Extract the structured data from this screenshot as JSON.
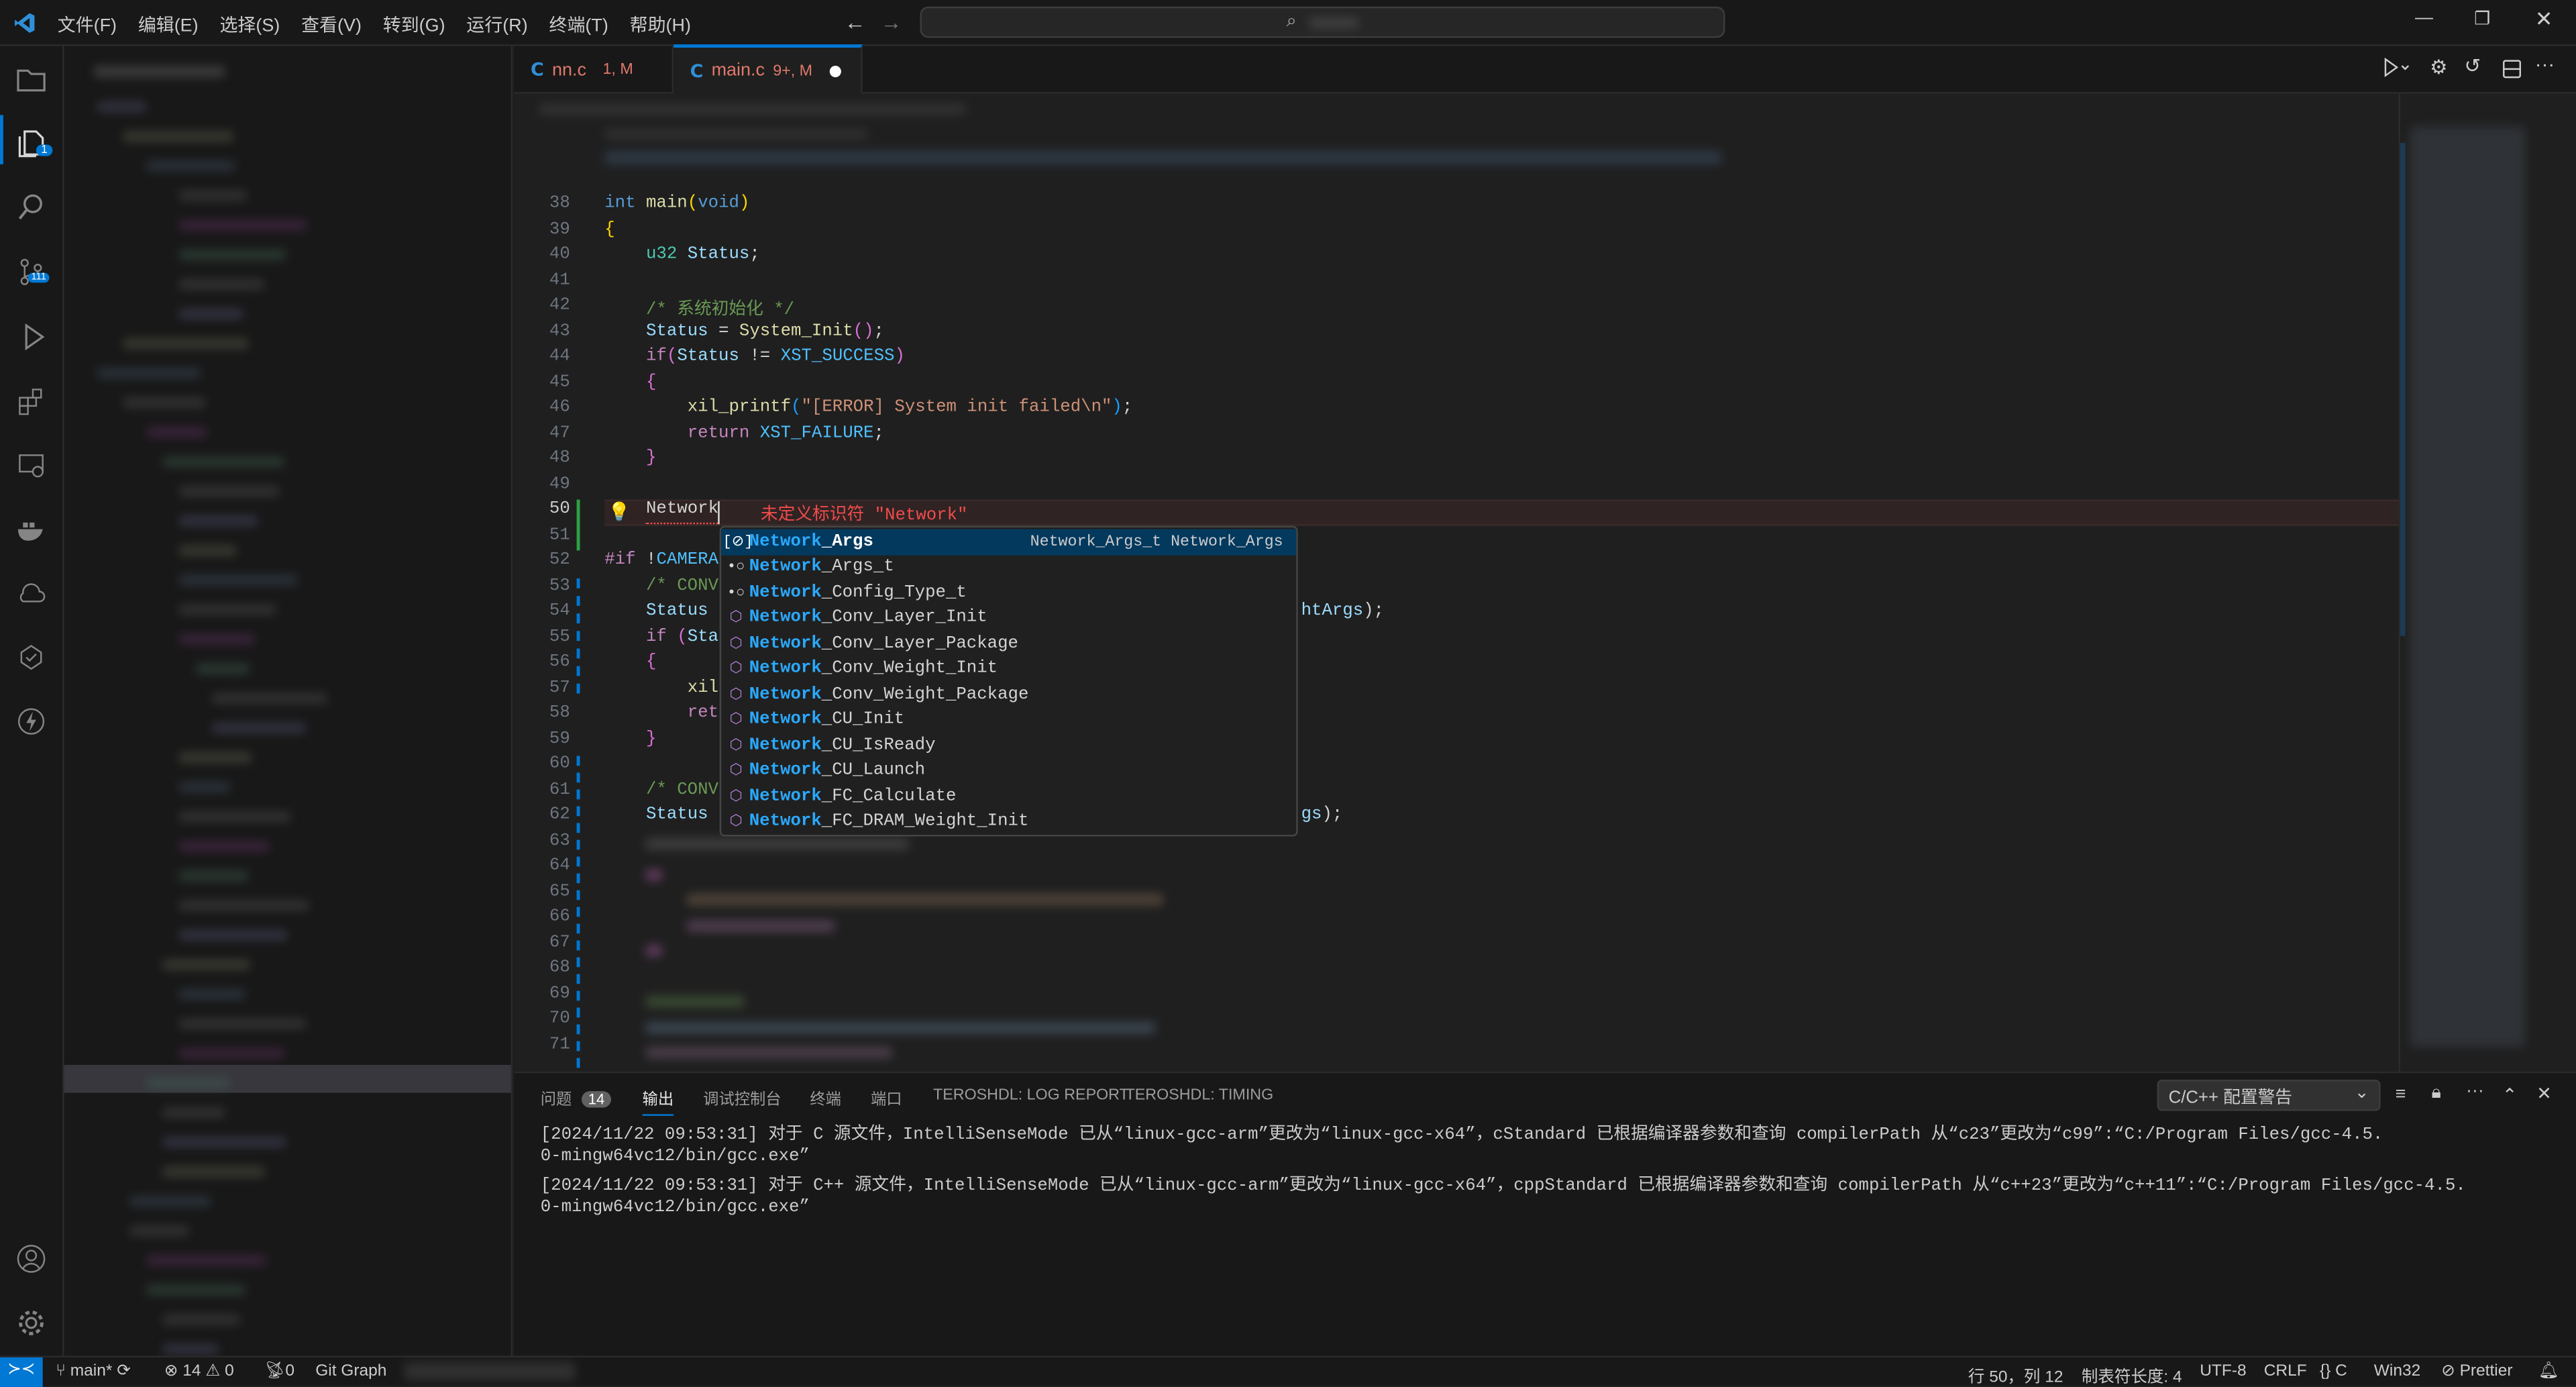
{
  "menu": [
    "文件(F)",
    "编辑(E)",
    "选择(S)",
    "查看(V)",
    "转到(G)",
    "运行(R)",
    "终端(T)",
    "帮助(H)"
  ],
  "tabs": [
    {
      "icon": "C",
      "name": "nn.c",
      "status": "1, M"
    },
    {
      "icon": "C",
      "name": "main.c",
      "status": "9+, M",
      "dirty": true
    }
  ],
  "activity": {
    "explorer_badge": "1",
    "scm_badge": "111"
  },
  "editor": {
    "lines": [
      {
        "n": "38",
        "t": [
          [
            "int ",
            "kw"
          ],
          [
            "main",
            "fn"
          ],
          [
            "(",
            "br1"
          ],
          [
            "void",
            "kw"
          ],
          [
            ")",
            "br1"
          ]
        ]
      },
      {
        "n": "39",
        "t": [
          [
            "{",
            "br1"
          ]
        ]
      },
      {
        "n": "40",
        "t": [
          [
            "    ",
            ""
          ],
          [
            "u32 ",
            "ty"
          ],
          [
            "Status",
            "va"
          ],
          [
            ";",
            "pl"
          ]
        ]
      },
      {
        "n": "41",
        "t": []
      },
      {
        "n": "42",
        "t": [
          [
            "    /* 系统初始化 */",
            "cm"
          ]
        ]
      },
      {
        "n": "43",
        "t": [
          [
            "    ",
            ""
          ],
          [
            "Status",
            "va"
          ],
          [
            " = ",
            "pl"
          ],
          [
            "System_Init",
            "fn"
          ],
          [
            "()",
            "br2"
          ],
          [
            ";",
            "pl"
          ]
        ]
      },
      {
        "n": "44",
        "t": [
          [
            "    ",
            ""
          ],
          [
            "if",
            "pk"
          ],
          [
            "(",
            "br2"
          ],
          [
            "Status",
            "va"
          ],
          [
            " != ",
            "pl"
          ],
          [
            "XST_SUCCESS",
            "cn"
          ],
          [
            ")",
            "br2"
          ]
        ]
      },
      {
        "n": "45",
        "t": [
          [
            "    ",
            ""
          ],
          [
            "{",
            "br2"
          ]
        ]
      },
      {
        "n": "46",
        "t": [
          [
            "        ",
            ""
          ],
          [
            "xil_printf",
            "fn"
          ],
          [
            "(",
            "br3"
          ],
          [
            "\"[ERROR] System init failed\\n\"",
            "str"
          ],
          [
            ")",
            "br3"
          ],
          [
            ";",
            "pl"
          ]
        ]
      },
      {
        "n": "47",
        "t": [
          [
            "        ",
            ""
          ],
          [
            "return ",
            "pk"
          ],
          [
            "XST_FAILURE",
            "cn"
          ],
          [
            ";",
            "pl"
          ]
        ]
      },
      {
        "n": "48",
        "t": [
          [
            "    ",
            ""
          ],
          [
            "}",
            "br2"
          ]
        ]
      },
      {
        "n": "49",
        "t": []
      },
      {
        "n": "50",
        "t": [
          [
            "    ",
            ""
          ],
          [
            "Network",
            "pl"
          ]
        ]
      },
      {
        "n": "51",
        "t": []
      },
      {
        "n": "52",
        "t": [
          [
            "#if ",
            "pk"
          ],
          [
            "!",
            "pl"
          ],
          [
            "CAMERA",
            "cn"
          ]
        ]
      },
      {
        "n": "53",
        "t": [
          [
            "    /* CONV",
            "cm"
          ]
        ]
      },
      {
        "n": "54",
        "t": [
          [
            "    ",
            ""
          ],
          [
            "Status",
            "va"
          ]
        ],
        "tail": [
          [
            "htArgs",
            "va"
          ],
          [
            ");",
            "pl"
          ]
        ]
      },
      {
        "n": "55",
        "t": [
          [
            "    ",
            ""
          ],
          [
            "if ",
            "pk"
          ],
          [
            "(",
            "br2"
          ],
          [
            "Sta",
            "va"
          ]
        ]
      },
      {
        "n": "56",
        "t": [
          [
            "    ",
            ""
          ],
          [
            "{",
            "br2"
          ]
        ]
      },
      {
        "n": "57",
        "t": [
          [
            "        ",
            ""
          ],
          [
            "xil",
            "fn"
          ]
        ]
      },
      {
        "n": "58",
        "t": [
          [
            "        ",
            ""
          ],
          [
            "ret",
            "pk"
          ]
        ]
      },
      {
        "n": "59",
        "t": [
          [
            "    ",
            ""
          ],
          [
            "}",
            "br2"
          ]
        ]
      },
      {
        "n": "60",
        "t": []
      },
      {
        "n": "61",
        "t": [
          [
            "    /* CONV",
            "cm"
          ]
        ]
      },
      {
        "n": "62",
        "t": [
          [
            "    ",
            ""
          ],
          [
            "Status",
            "va"
          ]
        ],
        "tail": [
          [
            "gs",
            "va"
          ],
          [
            ");",
            "pl"
          ]
        ]
      },
      {
        "n": "63",
        "t": []
      },
      {
        "n": "64",
        "t": []
      },
      {
        "n": "65",
        "t": []
      },
      {
        "n": "66",
        "t": []
      },
      {
        "n": "67",
        "t": []
      },
      {
        "n": "68",
        "t": []
      },
      {
        "n": "69",
        "t": []
      },
      {
        "n": "70",
        "t": []
      },
      {
        "n": "71",
        "t": []
      }
    ],
    "error_message": "未定义标识符 \"Network\""
  },
  "suggest": {
    "typed": "Network",
    "detail": "Network_Args_t Network_Args",
    "items": [
      {
        "kind": "variable",
        "rest": "_Args"
      },
      {
        "kind": "typedef",
        "rest": "_Args_t"
      },
      {
        "kind": "typedef",
        "rest": "_Config_Type_t"
      },
      {
        "kind": "function",
        "rest": "_Conv_Layer_Init"
      },
      {
        "kind": "function",
        "rest": "_Conv_Layer_Package"
      },
      {
        "kind": "function",
        "rest": "_Conv_Weight_Init"
      },
      {
        "kind": "function",
        "rest": "_Conv_Weight_Package"
      },
      {
        "kind": "function",
        "rest": "_CU_Init"
      },
      {
        "kind": "function",
        "rest": "_CU_IsReady"
      },
      {
        "kind": "function",
        "rest": "_CU_Launch"
      },
      {
        "kind": "function",
        "rest": "_FC_Calculate"
      },
      {
        "kind": "function",
        "rest": "_FC_DRAM_Weight_Init"
      }
    ]
  },
  "panel": {
    "tabs": [
      {
        "label": "问题",
        "badge": "14"
      },
      {
        "label": "输出",
        "active": true
      },
      {
        "label": "调试控制台"
      },
      {
        "label": "终端"
      },
      {
        "label": "端口"
      },
      {
        "label": "TEROSHDL: LOG REPORT"
      },
      {
        "label": "TEROSHDL: TIMING"
      }
    ],
    "channel": "C/C++ 配置警告",
    "output": [
      "[2024/11/22 09:53:31] 对于 C 源文件，IntelliSenseMode 已从“linux-gcc-arm”更改为“linux-gcc-x64”，cStandard 已根据编译器参数和查询 compilerPath 从“c23”更改为“c99”:“C:/Program Files/gcc-4.5.",
      "0-mingw64vc12/bin/gcc.exe”",
      "[2024/11/22 09:53:31] 对于 C++ 源文件，IntelliSenseMode 已从“linux-gcc-arm”更改为“linux-gcc-x64”，cppStandard 已根据编译器参数和查询 compilerPath 从“c++23”更改为“c++11”:“C:/Program Files/gcc-4.5.",
      "0-mingw64vc12/bin/gcc.exe”"
    ]
  },
  "status": {
    "branch": "main*",
    "errors": "14",
    "warnings": "0",
    "ports": "0",
    "git_graph": "Git Graph",
    "position": "行 50，列 12",
    "indent": "制表符长度: 4",
    "encoding": "UTF-8",
    "eol": "CRLF",
    "language": "C",
    "platform": "Win32",
    "prettier": "Prettier"
  },
  "colors": {
    "accent": "#0078d4",
    "error": "#f14c4c",
    "added": "#2ea043",
    "modified": "#0078d4"
  }
}
